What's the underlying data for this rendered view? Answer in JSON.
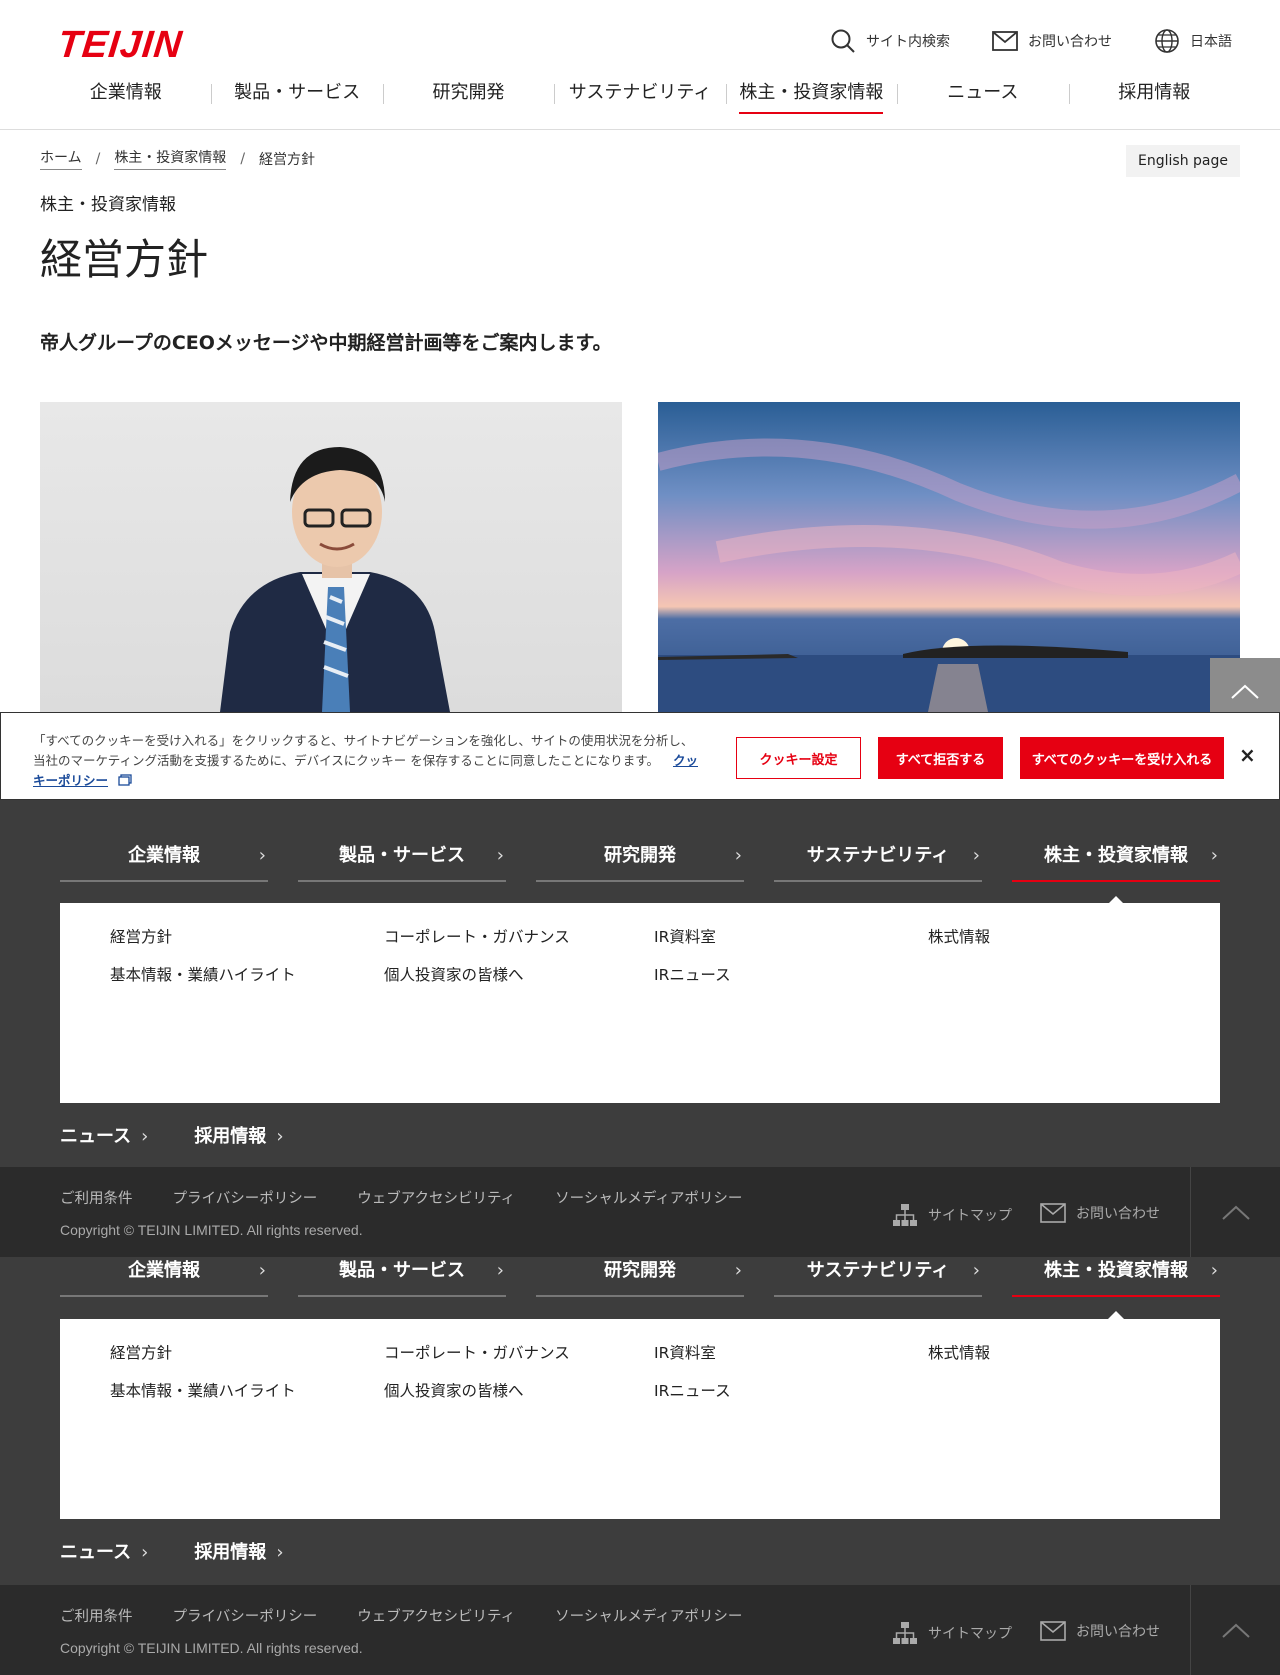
{
  "header": {
    "logo": "TEIJIN",
    "utils": {
      "search": "サイト内検索",
      "contact": "お問い合わせ",
      "language": "日本語"
    },
    "nav": [
      "企業情報",
      "製品・サービス",
      "研究開発",
      "サステナビリティ",
      "株主・投資家情報",
      "ニュース",
      "採用情報"
    ],
    "active_nav": "株主・投資家情報"
  },
  "breadcrumb": {
    "home": "ホーム",
    "parent": "株主・投資家情報",
    "current": "経営方針",
    "separator": "/"
  },
  "english_link": "English page",
  "page": {
    "category": "株主・投資家情報",
    "title": "経営方針",
    "lead": "帝人グループのCEOメッセージや中期経営計画等をご案内します。"
  },
  "cookie": {
    "text": "「すべてのクッキーを受け入れる」をクリックすると、サイトナビゲーションを強化し、サイトの使用状況を分析し、当社のマーケティング活動を支援するために、デバイスにクッキー を保存することに同意したことになります。",
    "policy_link": "クッキーポリシー",
    "settings_button": "クッキー設定",
    "reject_button": "すべて拒否する",
    "accept_button": "すべてのクッキーを受け入れる",
    "close": "×"
  },
  "footer_nav": {
    "tabs": [
      "企業情報",
      "製品・サービス",
      "研究開発",
      "サステナビリティ",
      "株主・投資家情報"
    ],
    "chevron": "›",
    "mega_col1": [
      "経営方針",
      "基本情報・業績ハイライト"
    ],
    "mega_col2": [
      "コーポレート・ガバナンス",
      "個人投資家の皆様へ"
    ],
    "mega_col3": [
      "IR資料室",
      "IRニュース"
    ],
    "mega_col4": [
      "株式情報"
    ],
    "sub": [
      "ニュース",
      "採用情報"
    ]
  },
  "footer": {
    "links": [
      "ご利用条件",
      "プライバシーポリシー",
      "ウェブアクセシビリティ",
      "ソーシャルメディアポリシー"
    ],
    "copyright": "Copyright © TEIJIN LIMITED. All rights reserved.",
    "sitemap": "サイトマップ",
    "contact": "お問い合わせ"
  },
  "colors": {
    "brand_red": "#e60012",
    "footer_bg": "#3d3d3d",
    "footer_bar": "#2b2b2b"
  }
}
